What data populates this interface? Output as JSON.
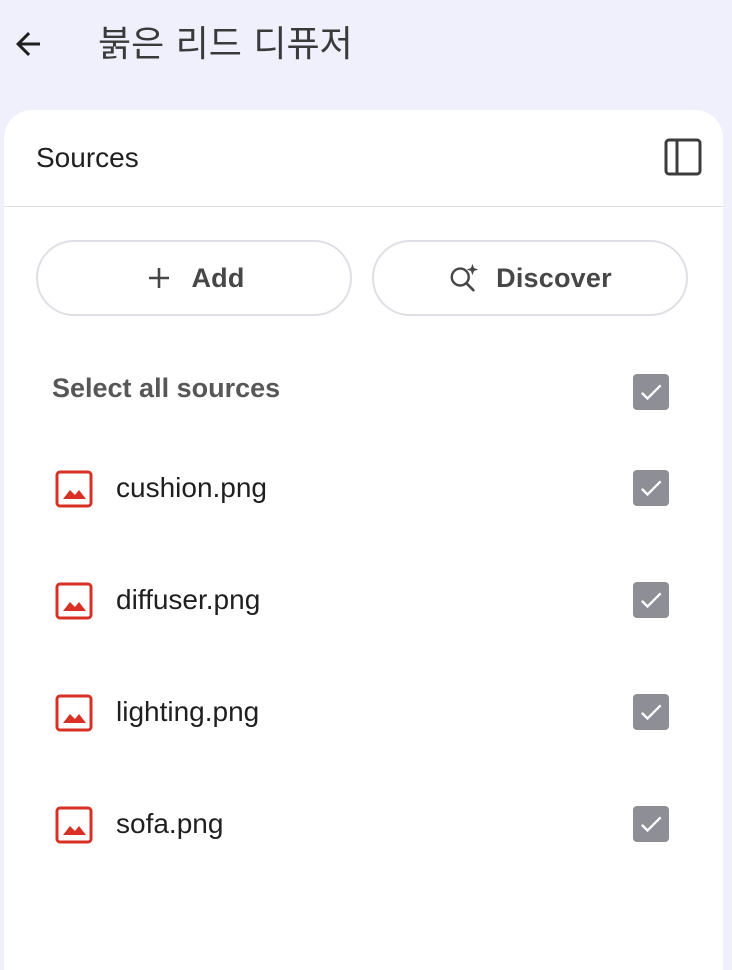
{
  "header": {
    "title": "붉은 리드 디퓨저",
    "back_icon": "arrow-left-icon"
  },
  "sources_panel": {
    "title": "Sources",
    "toggle_icon": "side-panel-icon",
    "add_label": "Add",
    "discover_label": "Discover",
    "select_all_label": "Select all sources",
    "select_all_checked": true,
    "items": [
      {
        "name": "cushion.png",
        "icon": "image-file-icon",
        "checked": true
      },
      {
        "name": "diffuser.png",
        "icon": "image-file-icon",
        "checked": true
      },
      {
        "name": "lighting.png",
        "icon": "image-file-icon",
        "checked": true
      },
      {
        "name": "sofa.png",
        "icon": "image-file-icon",
        "checked": true
      }
    ]
  },
  "colors": {
    "background": "#eff0fb",
    "panel": "#ffffff",
    "file_icon": "#d93025",
    "checkbox": "#8e8f96"
  }
}
